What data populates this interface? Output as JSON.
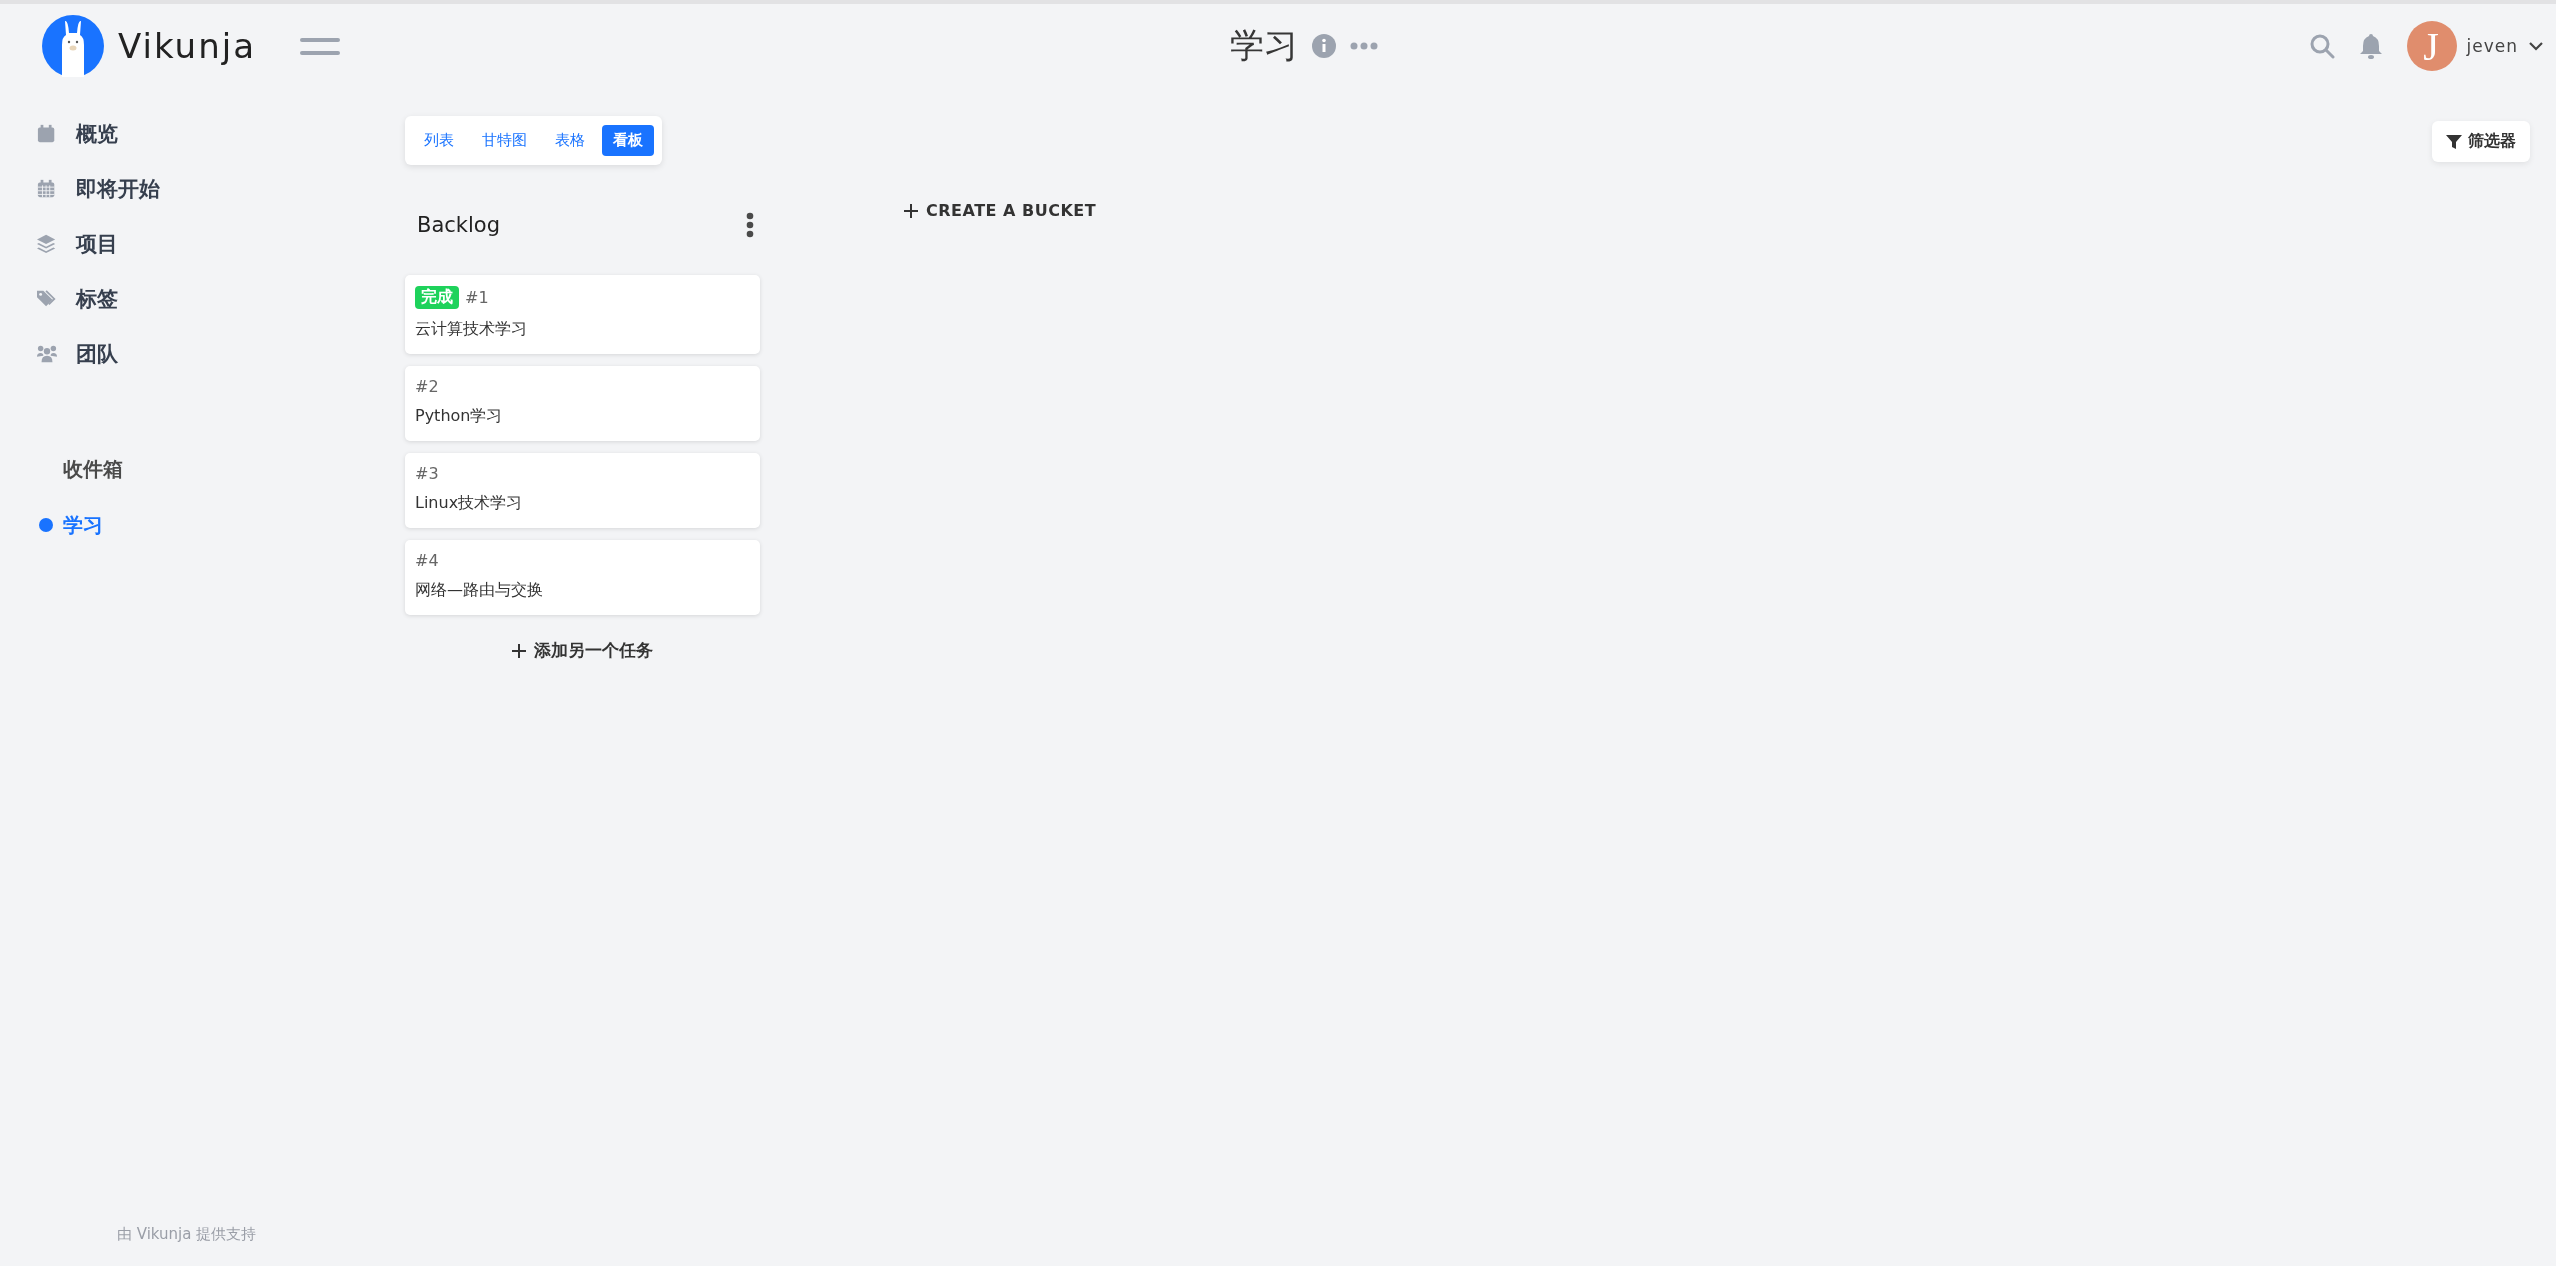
{
  "header": {
    "logo_text": "Vikunja",
    "title": "学习",
    "user": {
      "initial": "J",
      "name": "jeven"
    }
  },
  "sidebar": {
    "menu": [
      {
        "label": "概览"
      },
      {
        "label": "即将开始"
      },
      {
        "label": "项目"
      },
      {
        "label": "标签"
      },
      {
        "label": "团队"
      }
    ],
    "projects": [
      {
        "label": "收件箱",
        "selected": false
      },
      {
        "label": "学习",
        "selected": true,
        "color": "#1973ff"
      }
    ],
    "footer": "由 Vikunja 提供支持"
  },
  "views": [
    {
      "label": "列表",
      "selected": false
    },
    {
      "label": "甘特图",
      "selected": false
    },
    {
      "label": "表格",
      "selected": false
    },
    {
      "label": "看板",
      "selected": true
    }
  ],
  "filter_button": "筛选器",
  "buckets": [
    {
      "title": "Backlog",
      "add_task": "添加另一个任务",
      "tasks": [
        {
          "id": "#1",
          "title": "云计算技术学习",
          "done": true,
          "done_badge": "完成"
        },
        {
          "id": "#2",
          "title": "Python学习",
          "done": false
        },
        {
          "id": "#3",
          "title": "Linux技术学习",
          "done": false
        },
        {
          "id": "#4",
          "title": "网络—路由与交换",
          "done": false
        }
      ]
    }
  ],
  "create_bucket": "CREATE A BUCKET"
}
